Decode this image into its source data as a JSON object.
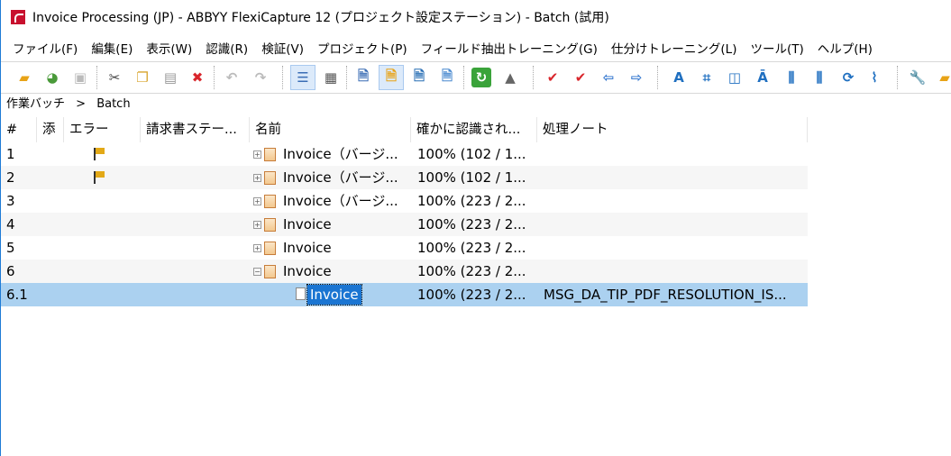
{
  "window": {
    "title": "Invoice Processing (JP) - ABBYY FlexiCapture 12 (プロジェクト設定ステーション) - Batch (試用)"
  },
  "menu": [
    "ファイル(F)",
    "編集(E)",
    "表示(W)",
    "認識(R)",
    "検証(V)",
    "プロジェクト(P)",
    "フィールド抽出トレーニング(G)",
    "仕分けトレーニング(L)",
    "ツール(T)",
    "ヘルプ(H)"
  ],
  "breadcrumb": {
    "root": "作業バッチ",
    "sep": ">",
    "current": "Batch"
  },
  "columns": [
    "#",
    "添",
    "エラー",
    "請求書ステー...",
    "名前",
    "確かに認識され...",
    "処理ノート"
  ],
  "rows": [
    {
      "num": "1",
      "flag": true,
      "name": "Invoice（バージ...",
      "recog": "100% (102 / 1...",
      "note": ""
    },
    {
      "num": "2",
      "flag": true,
      "name": "Invoice（バージ...",
      "recog": "100% (102 / 1...",
      "note": ""
    },
    {
      "num": "3",
      "flag": false,
      "name": "Invoice（バージ...",
      "recog": "100% (223 / 2...",
      "note": ""
    },
    {
      "num": "4",
      "flag": false,
      "name": "Invoice",
      "recog": "100% (223 / 2...",
      "note": ""
    },
    {
      "num": "5",
      "flag": false,
      "name": "Invoice",
      "recog": "100% (223 / 2...",
      "note": ""
    },
    {
      "num": "6",
      "flag": false,
      "name": "Invoice",
      "recog": "100% (223 / 2...",
      "note": ""
    },
    {
      "num": "6.1",
      "flag": false,
      "name": "Invoice",
      "recog": "100% (223 / 2...",
      "note": "MSG_DA_TIP_PDF_RESOLUTION_IS..."
    }
  ]
}
